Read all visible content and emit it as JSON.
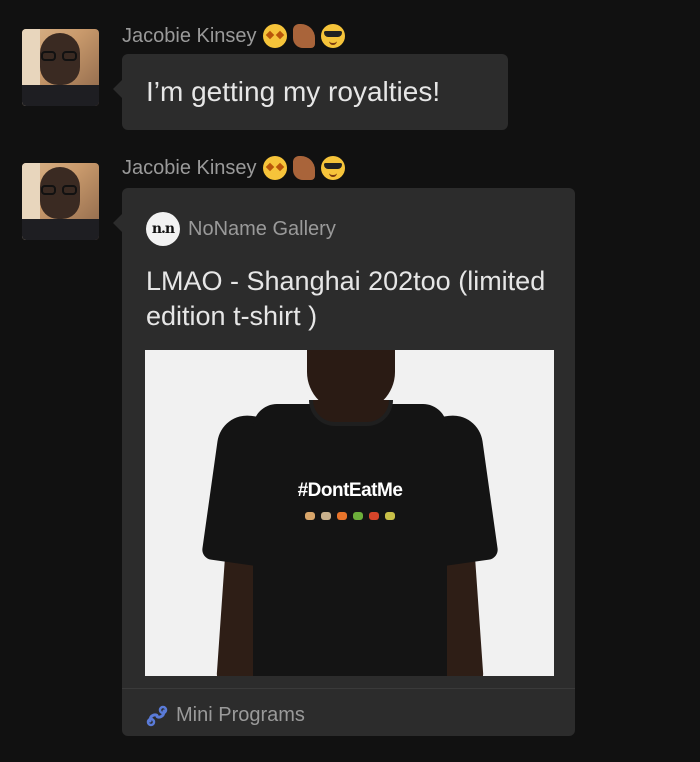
{
  "messages": [
    {
      "sender": "Jacobie Kinsey",
      "sender_emojis": [
        "star-struck-emoji",
        "flexed-biceps-emoji",
        "sunglasses-emoji"
      ],
      "text": "I’m getting my royalties!"
    },
    {
      "sender": "Jacobie Kinsey",
      "sender_emojis": [
        "star-struck-emoji",
        "flexed-biceps-emoji",
        "sunglasses-emoji"
      ],
      "card": {
        "source_logo": "n.n",
        "source_name": "NoName Gallery",
        "title": "LMAO - Shanghai 202too (limited edition t-shirt )",
        "image_print_text": "#DontEatMe",
        "footer_label": "Mini Programs"
      }
    }
  ],
  "colors": {
    "background": "#111111",
    "bubble": "#2c2c2c",
    "meta_text": "#9a9a9a",
    "body_text": "#e6e6e6",
    "mini_program_icon": "#5a7bd8"
  }
}
